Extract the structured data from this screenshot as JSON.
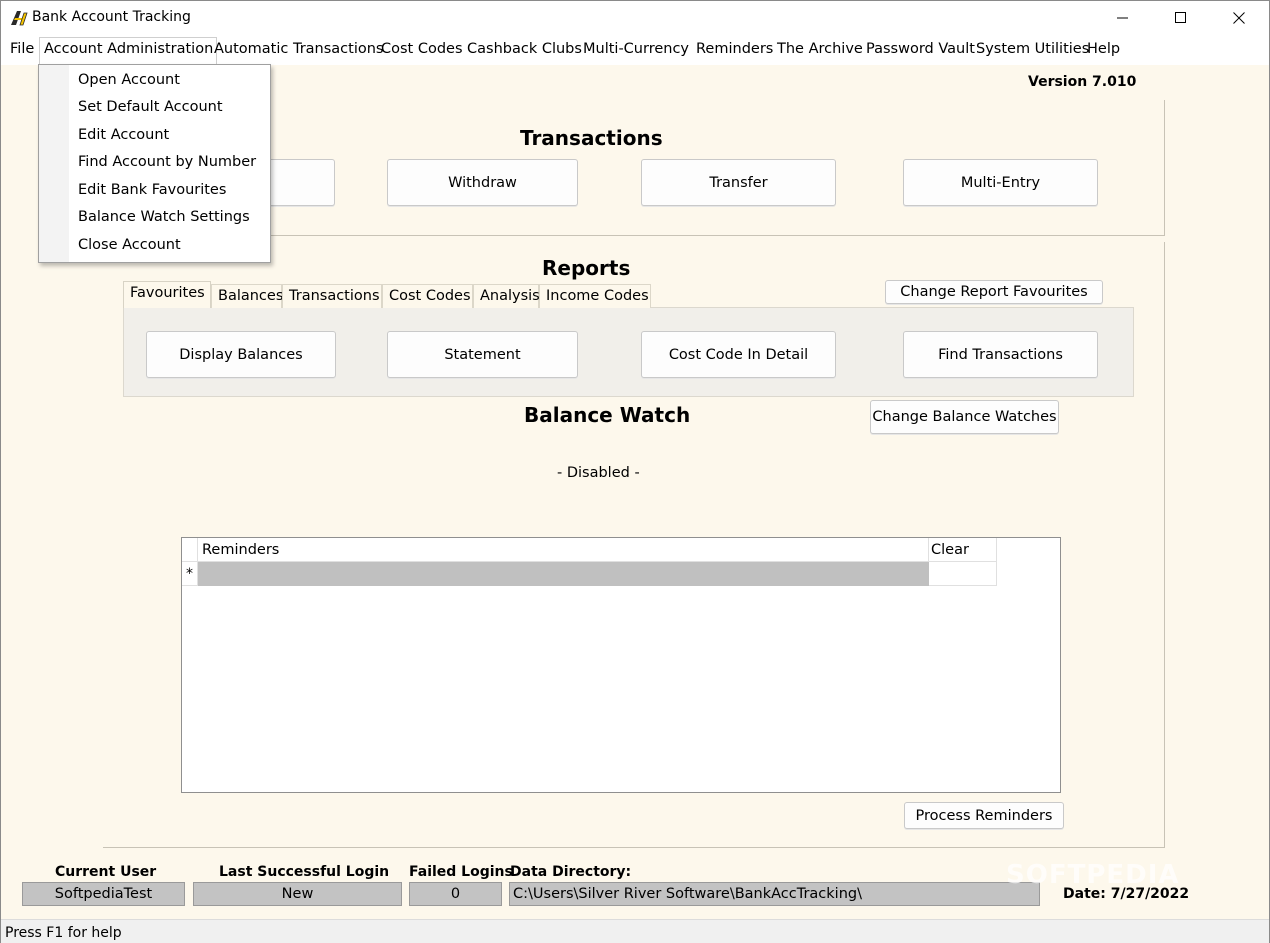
{
  "window": {
    "title": "Bank Account Tracking"
  },
  "menu": {
    "file": "File",
    "account_admin": "Account Administration",
    "automatic": "Automatic Transactions",
    "cost_codes": "Cost Codes",
    "cashback": "Cashback Clubs",
    "multi_currency": "Multi-Currency",
    "reminders": "Reminders",
    "archive": "The Archive",
    "password_vault": "Password Vault",
    "system_utilities": "System Utilities",
    "help": "Help"
  },
  "dropdown": {
    "items": [
      "Open Account",
      "Set Default Account",
      "Edit Account",
      "Find Account by Number",
      "Edit Bank Favourites",
      "Balance Watch Settings",
      "Close Account"
    ]
  },
  "version": "Version 7.010",
  "transactions": {
    "title": "Transactions",
    "withdraw": "Withdraw",
    "transfer": "Transfer",
    "multi_entry": "Multi-Entry"
  },
  "reports": {
    "title": "Reports",
    "tabs": [
      "Favourites",
      "Balances",
      "Transactions",
      "Cost Codes",
      "Analysis",
      "Income Codes"
    ],
    "change_favourites": "Change Report Favourites",
    "buttons": [
      "Display Balances",
      "Statement",
      "Cost Code In Detail",
      "Find Transactions"
    ]
  },
  "balance_watch": {
    "title": "Balance Watch",
    "change_button": "Change Balance Watches",
    "status": "- Disabled -"
  },
  "reminders_grid": {
    "col_reminders": "Reminders",
    "col_clear": "Clear",
    "new_row_marker": "*",
    "process_button": "Process Reminders"
  },
  "status_info": {
    "current_user_label": "Current User",
    "current_user": "SoftpediaTest",
    "last_login_label": "Last Successful Login",
    "last_login": "New",
    "failed_logins_label": "Failed Logins",
    "failed_logins": "0",
    "data_dir_label": "Data Directory:",
    "data_dir": "C:\\Users\\Silver River Software\\BankAccTracking\\",
    "date": "Date: 7/27/2022",
    "watermark": "SOFTPEDIA"
  },
  "statusbar": {
    "help_text": "Press F1 for help"
  },
  "colors": {
    "client_bg": "#fdf8ec",
    "status_box_bg": "#c3c3c3",
    "grid_selected": "#c0c0c0"
  }
}
